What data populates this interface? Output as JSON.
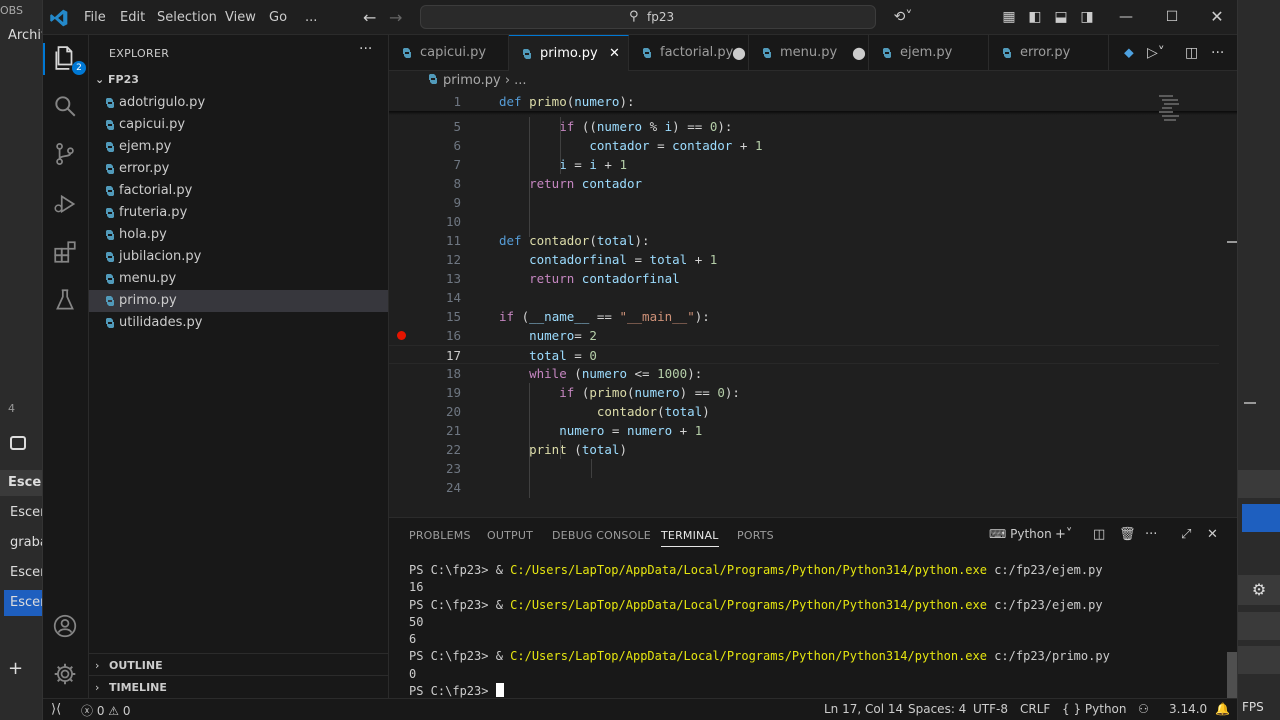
{
  "obs_left": {
    "labels": [
      "OBS",
      "Archiv",
      "4",
      "Escen",
      "Escen",
      "graba",
      "Escen",
      "Escen"
    ]
  },
  "obs_right": {
    "fps": "FPS"
  },
  "titlebar": {
    "menu": [
      "File",
      "Edit",
      "Selection",
      "View",
      "Go",
      "..."
    ],
    "search": "fp23"
  },
  "activity": {
    "badge": "2"
  },
  "explorer": {
    "title": "EXPLORER",
    "folder": "FP23",
    "files": [
      "adotrigulo.py",
      "capicui.py",
      "ejem.py",
      "error.py",
      "factorial.py",
      "fruteria.py",
      "hola.py",
      "jubilacion.py",
      "menu.py",
      "primo.py",
      "utilidades.py"
    ],
    "selected": "primo.py",
    "outline": "OUTLINE",
    "timeline": "TIMELINE"
  },
  "tabs": [
    {
      "name": "capicui.py",
      "state": ""
    },
    {
      "name": "primo.py",
      "state": "active"
    },
    {
      "name": "factorial.py",
      "state": "dirty"
    },
    {
      "name": "menu.py",
      "state": "dirty"
    },
    {
      "name": "ejem.py",
      "state": ""
    },
    {
      "name": "error.py",
      "state": ""
    }
  ],
  "breadcrumb": {
    "file": "primo.py",
    "rest": "..."
  },
  "code": {
    "current_line": 17,
    "breakpoint_line": 16,
    "lines": [
      {
        "n": 1,
        "text": "def primo(numero):"
      },
      {
        "n": 5,
        "text": "        if ((numero % i) == 0):"
      },
      {
        "n": 6,
        "text": "            contador = contador + 1"
      },
      {
        "n": 7,
        "text": "        i = i + 1"
      },
      {
        "n": 8,
        "text": "    return contador"
      },
      {
        "n": 9,
        "text": ""
      },
      {
        "n": 10,
        "text": ""
      },
      {
        "n": 11,
        "text": "def contador(total):"
      },
      {
        "n": 12,
        "text": "    contadorfinal = total + 1"
      },
      {
        "n": 13,
        "text": "    return contadorfinal"
      },
      {
        "n": 14,
        "text": ""
      },
      {
        "n": 15,
        "text": "if (__name__ == \"__main__\"):"
      },
      {
        "n": 16,
        "text": "    numero= 2"
      },
      {
        "n": 17,
        "text": "    total = 0"
      },
      {
        "n": 18,
        "text": "    while (numero <= 1000):"
      },
      {
        "n": 19,
        "text": "        if (primo(numero) == 0):"
      },
      {
        "n": 20,
        "text": "             contador(total)"
      },
      {
        "n": 21,
        "text": "        numero = numero + 1"
      },
      {
        "n": 22,
        "text": "    print (total)"
      },
      {
        "n": 23,
        "text": ""
      },
      {
        "n": 24,
        "text": ""
      }
    ]
  },
  "panel": {
    "tabs": [
      "PROBLEMS",
      "OUTPUT",
      "DEBUG CONSOLE",
      "TERMINAL",
      "PORTS"
    ],
    "active": "TERMINAL",
    "shell": "Python",
    "lines": [
      {
        "prompt": "PS C:\\fp23> ",
        "amp": "& ",
        "exe": "C:/Users/LapTop/AppData/Local/Programs/Python/Python314/python.exe",
        "arg": " c:/fp23/ejem.py"
      },
      {
        "out": "16"
      },
      {
        "prompt": "PS C:\\fp23> ",
        "amp": "& ",
        "exe": "C:/Users/LapTop/AppData/Local/Programs/Python/Python314/python.exe",
        "arg": " c:/fp23/ejem.py"
      },
      {
        "out": "50"
      },
      {
        "out": "6"
      },
      {
        "prompt": "PS C:\\fp23> ",
        "amp": "& ",
        "exe": "C:/Users/LapTop/AppData/Local/Programs/Python/Python314/python.exe",
        "arg": " c:/fp23/primo.py"
      },
      {
        "out": "0"
      },
      {
        "prompt": "PS C:\\fp23> ",
        "cursor": true
      }
    ]
  },
  "status": {
    "errors": "0",
    "warnings": "0",
    "position": "Ln 17, Col 14",
    "spaces": "Spaces: 4",
    "encoding": "UTF-8",
    "eol": "CRLF",
    "language": "Python",
    "version": "3.14.0"
  },
  "colors": {
    "accent": "#0078d4",
    "breakpoint": "#e51400",
    "python_icon": "#519aba"
  }
}
